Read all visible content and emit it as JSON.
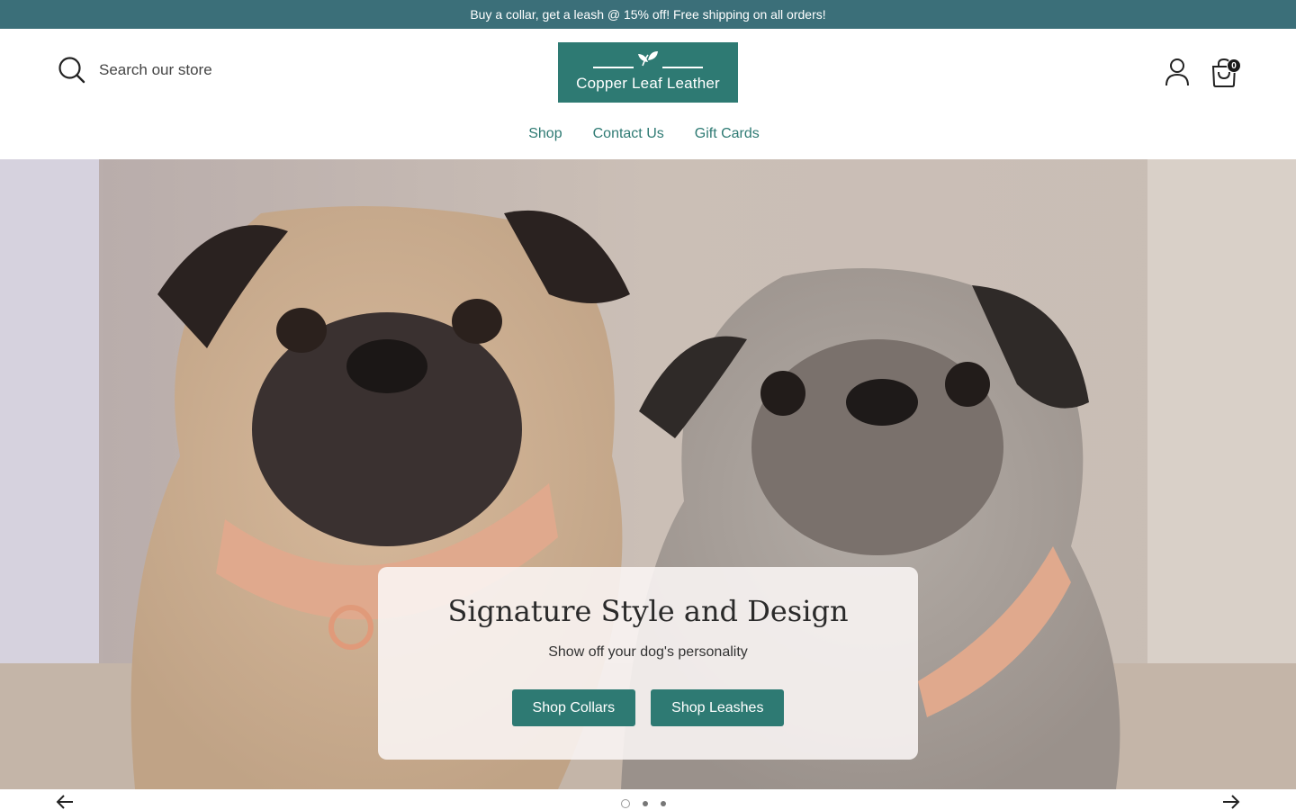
{
  "announcement": {
    "text": "Buy a collar, get a leash @ 15% off! Free shipping on all orders!"
  },
  "header": {
    "search": {
      "placeholder": "Search our store",
      "icon": "search-icon"
    },
    "logo": {
      "text": "Copper Leaf Leather"
    },
    "account": {
      "icon": "account-icon"
    },
    "cart": {
      "icon": "cart-icon",
      "count": "0"
    }
  },
  "nav": {
    "items": [
      {
        "label": "Shop"
      },
      {
        "label": "Contact Us"
      },
      {
        "label": "Gift Cards"
      }
    ]
  },
  "hero": {
    "title": "Signature Style and Design",
    "subtitle": "Show off your dog's personality",
    "buttons": [
      {
        "label": "Shop Collars"
      },
      {
        "label": "Shop Leashes"
      }
    ],
    "image": "two-pugs-wearing-leather-collars"
  },
  "slider": {
    "slide_count": 3,
    "active_index": 0,
    "prev_icon": "arrow-left-icon",
    "next_icon": "arrow-right-icon"
  },
  "colors": {
    "announcement_bg": "#3b6f79",
    "brand_green": "#2e7a73",
    "nav_link": "#2e7a73"
  }
}
